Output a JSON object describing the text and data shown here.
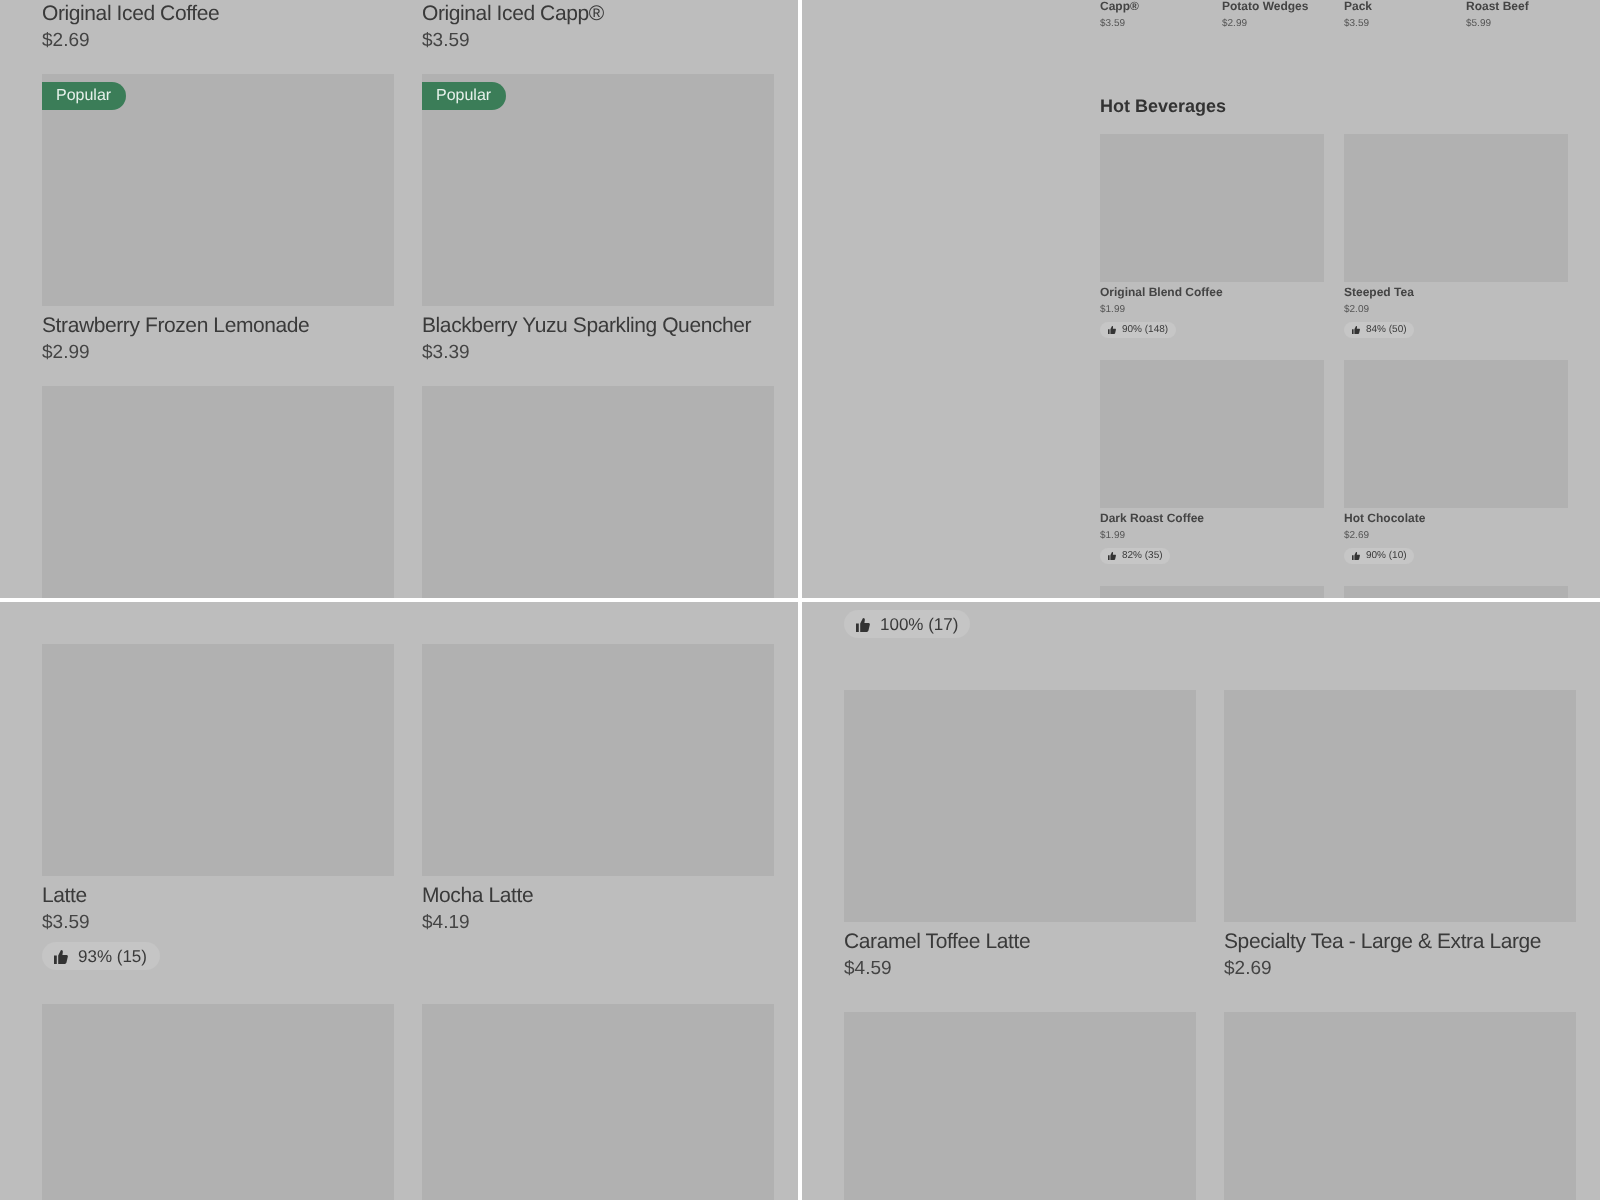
{
  "panels": [
    {
      "kind": "large",
      "sections": [
        {
          "kind": "grid",
          "items": [
            {
              "name": "Original Iced Coffee",
              "price": "$2.69",
              "image": false
            },
            {
              "name": "Original Iced Capp®",
              "price": "$3.59",
              "image": false
            },
            {
              "name": "Strawberry Frozen Lemonade",
              "price": "$2.99",
              "image": true,
              "badge": "Popular"
            },
            {
              "name": "Blackberry Yuzu Sparkling Quencher",
              "price": "$3.39",
              "image": true,
              "badge": "Popular"
            },
            {
              "image": true
            },
            {
              "image": true
            }
          ]
        }
      ]
    },
    {
      "kind": "small",
      "sections": [
        {
          "kind": "strip",
          "items": [
            {
              "name": "Capp®",
              "price": "$3.59",
              "image": false
            },
            {
              "name": "Potato Wedges",
              "price": "$2.99",
              "image": false
            },
            {
              "name": "Pack",
              "price": "$3.59",
              "image": false
            },
            {
              "name": "Roast Beef",
              "price": "$5.99",
              "image": false
            }
          ]
        },
        {
          "kind": "grid",
          "heading": "Hot Beverages",
          "items": [
            {
              "name": "Original Blend Coffee",
              "price": "$1.99",
              "image": true,
              "rating": "90% (148)"
            },
            {
              "name": "Steeped Tea",
              "price": "$2.09",
              "image": true,
              "rating": "84% (50)"
            },
            {
              "name": "Dark Roast Coffee",
              "price": "$1.99",
              "image": true,
              "rating": "82% (35)"
            },
            {
              "name": "Hot Chocolate",
              "price": "$2.69",
              "image": true,
              "rating": "90% (10)"
            },
            {
              "image": true
            },
            {
              "image": true
            }
          ]
        }
      ]
    },
    {
      "kind": "large",
      "sections": [
        {
          "kind": "grid",
          "items": [
            {
              "name": "Latte",
              "price": "$3.59",
              "image": true,
              "rating": "93% (15)"
            },
            {
              "name": "Mocha Latte",
              "price": "$4.19",
              "image": true
            },
            {
              "image": true
            },
            {
              "image": true
            }
          ]
        }
      ]
    },
    {
      "kind": "large",
      "sections": [
        {
          "kind": "grid",
          "items": [
            {
              "image": false,
              "rating": "100% (17)"
            },
            {
              "image": false
            },
            {
              "name": "Caramel Toffee Latte",
              "price": "$4.59",
              "image": true
            },
            {
              "name": "Specialty Tea - Large & Extra Large",
              "price": "$2.69",
              "image": true
            },
            {
              "image": true
            },
            {
              "image": true
            }
          ]
        }
      ]
    }
  ]
}
